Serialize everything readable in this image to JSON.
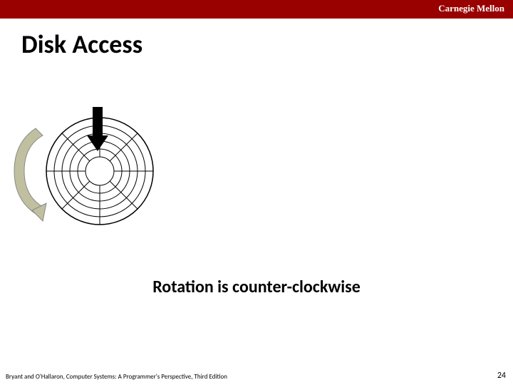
{
  "header": {
    "brand": "Carnegie Mellon"
  },
  "title": "Disk Access",
  "caption": "Rotation is counter-clockwise",
  "footer": {
    "left": "Bryant and O'Hallaron, Computer Systems: A Programmer's Perspective, Third Edition",
    "page": "24"
  }
}
